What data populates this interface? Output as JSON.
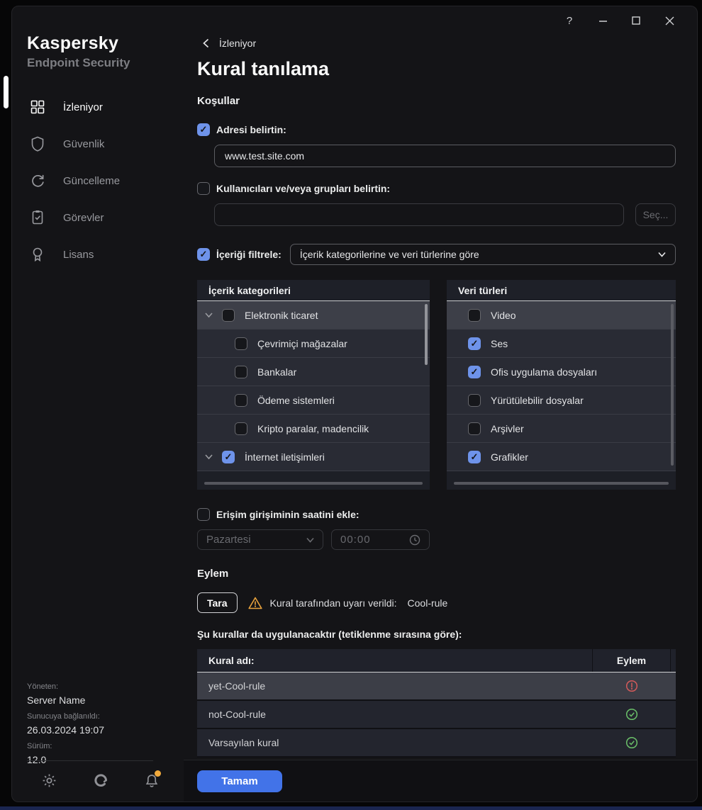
{
  "window": {
    "controls": {
      "help": "?",
      "minimize": "minimize",
      "maximize": "maximize",
      "close": "close"
    }
  },
  "sidebar": {
    "brand_title": "Kaspersky",
    "brand_subtitle": "Endpoint Security",
    "items": [
      {
        "label": "İzleniyor",
        "icon": "dashboard",
        "active": true
      },
      {
        "label": "Güvenlik",
        "icon": "shield",
        "active": false
      },
      {
        "label": "Güncelleme",
        "icon": "refresh",
        "active": false
      },
      {
        "label": "Görevler",
        "icon": "tasks",
        "active": false
      },
      {
        "label": "Lisans",
        "icon": "license",
        "active": false
      }
    ],
    "footer": {
      "managed_label": "Yöneten:",
      "managed_value": "Server Name",
      "connected_label": "Sunucuya bağlanıldı:",
      "connected_value": "26.03.2024 19:07",
      "version_label": "Sürüm:",
      "version_value": "12.0"
    },
    "has_notification": true
  },
  "header": {
    "back_label": "İzleniyor",
    "title": "Kural tanılama"
  },
  "conditions": {
    "section_title": "Koşullar",
    "address": {
      "label": "Adresi belirtin:",
      "checked": true,
      "value": "www.test.site.com"
    },
    "users": {
      "label": "Kullanıcıları ve/veya grupları belirtin:",
      "checked": false,
      "value": "",
      "select_button": "Seç..."
    },
    "content_filter": {
      "label": "İçeriği filtrele:",
      "checked": true,
      "dropdown_value": "İçerik kategorilerine ve veri türlerine göre"
    },
    "categories": {
      "header": "İçerik kategorileri",
      "items": [
        {
          "label": "Elektronik ticaret",
          "checked": false,
          "expandable": true,
          "indent": false,
          "highlighted": true
        },
        {
          "label": "Çevrimiçi mağazalar",
          "checked": false,
          "expandable": false,
          "indent": true,
          "highlighted": false
        },
        {
          "label": "Bankalar",
          "checked": false,
          "expandable": false,
          "indent": true,
          "highlighted": false
        },
        {
          "label": "Ödeme sistemleri",
          "checked": false,
          "expandable": false,
          "indent": true,
          "highlighted": false
        },
        {
          "label": "Kripto paralar, madencilik",
          "checked": false,
          "expandable": false,
          "indent": true,
          "highlighted": false
        },
        {
          "label": "İnternet iletişimleri",
          "checked": true,
          "expandable": true,
          "indent": false,
          "highlighted": false
        }
      ]
    },
    "data_types": {
      "header": "Veri türleri",
      "items": [
        {
          "label": "Video",
          "checked": false,
          "highlighted": true
        },
        {
          "label": "Ses",
          "checked": true,
          "highlighted": false
        },
        {
          "label": "Ofis uygulama dosyaları",
          "checked": true,
          "highlighted": false
        },
        {
          "label": "Yürütülebilir dosyalar",
          "checked": false,
          "highlighted": false
        },
        {
          "label": "Arşivler",
          "checked": false,
          "highlighted": false
        },
        {
          "label": "Grafikler",
          "checked": true,
          "highlighted": false
        }
      ]
    },
    "time": {
      "label": "Erişim girişiminin saatini ekle:",
      "checked": false,
      "day_value": "Pazartesi",
      "time_value": "00:00"
    }
  },
  "action": {
    "section_title": "Eylem",
    "scan_button": "Tara",
    "warning_text": "Kural tarafından uyarı verildi:",
    "warning_rule": "Cool-rule",
    "table_caption": "Şu kurallar da uygulanacaktır (tetiklenme sırasına göre):",
    "table": {
      "columns": [
        "Kural adı:",
        "Eylem"
      ],
      "rows": [
        {
          "name": "yet-Cool-rule",
          "status": "warning",
          "highlighted": true
        },
        {
          "name": "not-Cool-rule",
          "status": "ok",
          "highlighted": false
        },
        {
          "name": "Varsayılan kural",
          "status": "ok",
          "highlighted": false
        }
      ]
    }
  },
  "footer": {
    "ok_button": "Tamam"
  },
  "colors": {
    "accent_checkbox": "#6e93ea",
    "primary_button": "#4273e8",
    "warning": "#e8a33d",
    "error": "#d35a5a",
    "success": "#6abf69",
    "notification_dot": "#f0a93c"
  }
}
